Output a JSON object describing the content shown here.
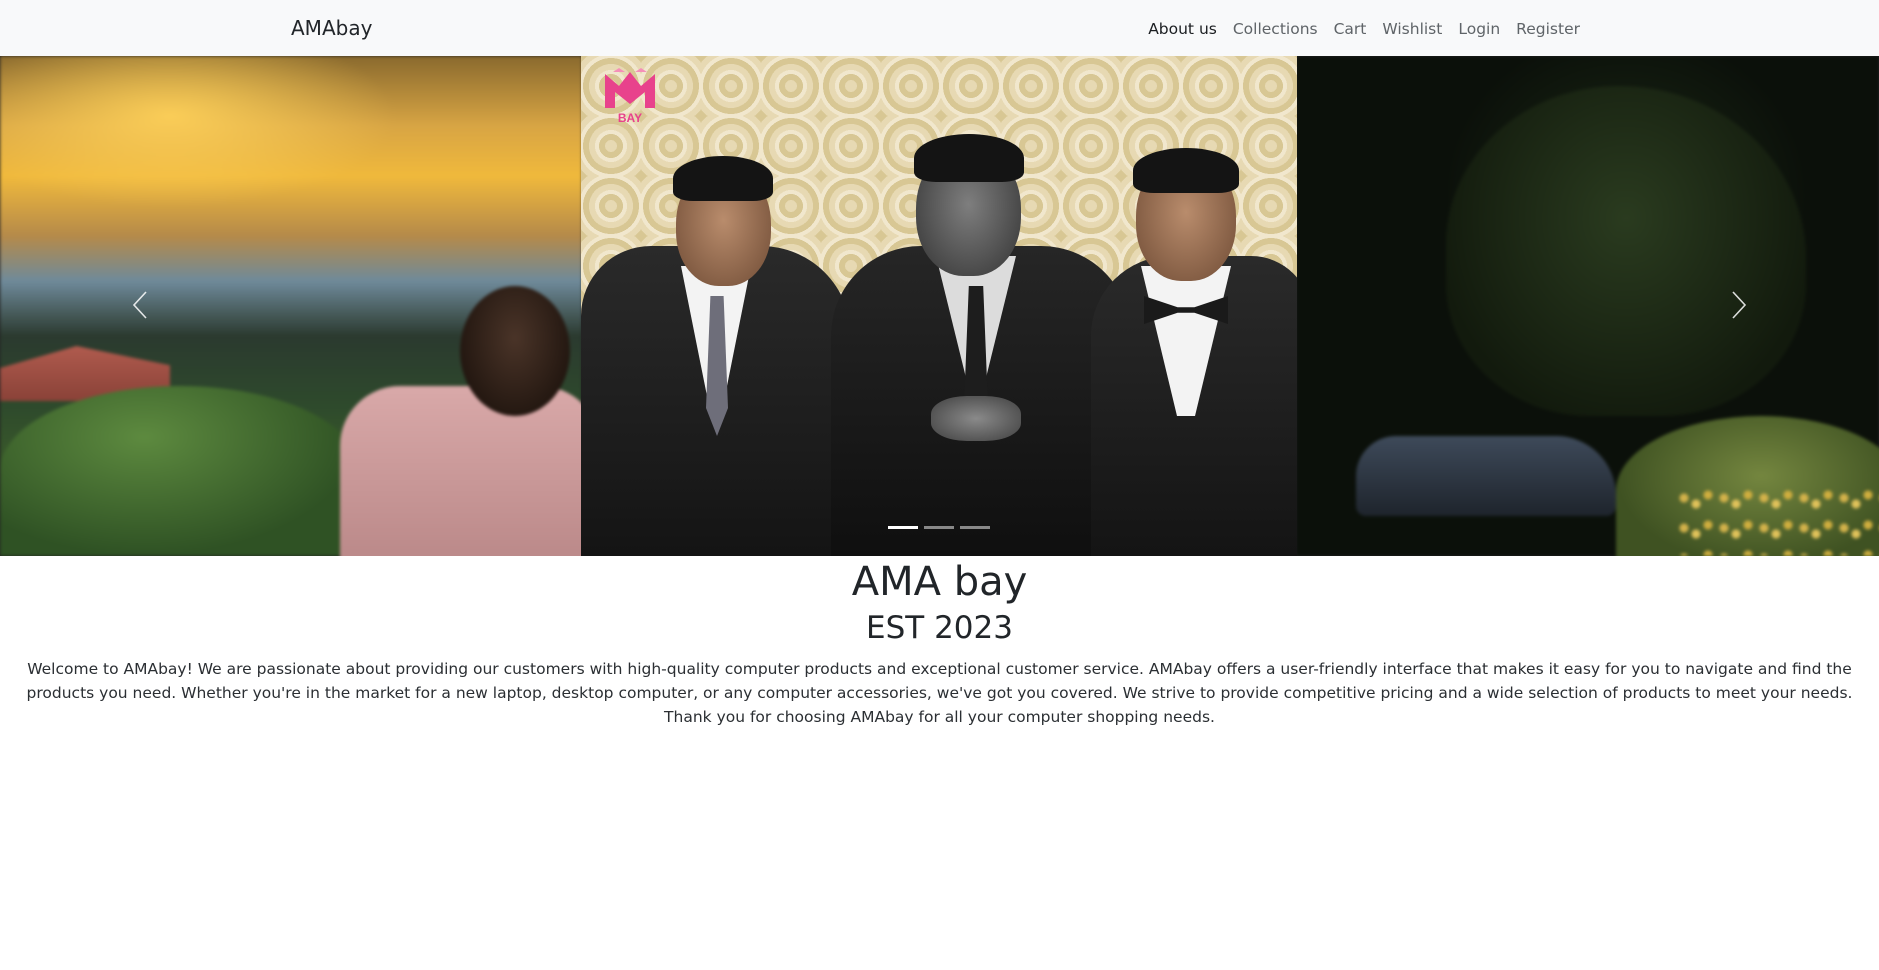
{
  "navbar": {
    "brand": "AMAbay",
    "links": [
      {
        "label": "About us",
        "active": true
      },
      {
        "label": "Collections",
        "active": false
      },
      {
        "label": "Cart",
        "active": false
      },
      {
        "label": "Wishlist",
        "active": false
      },
      {
        "label": "Login",
        "active": false
      },
      {
        "label": "Register",
        "active": false
      }
    ]
  },
  "carousel": {
    "logo_text": "BAY",
    "prev_icon": "chevron-left-icon",
    "next_icon": "chevron-right-icon",
    "slide_count": 3,
    "active_slide": 1
  },
  "about": {
    "title": "AMA bay",
    "subtitle": "EST 2023",
    "description": "Welcome to AMAbay! We are passionate about providing our customers with high-quality computer products and exceptional customer service. AMAbay offers a user-friendly interface that makes it easy for you to navigate and find the products you need. Whether you're in the market for a new laptop, desktop computer, or any computer accessories, we've got you covered. We strive to provide competitive pricing and a wide selection of products to meet your needs. Thank you for choosing AMAbay for all your computer shopping needs."
  },
  "colors": {
    "navbar_bg": "#f8f9fa",
    "text": "#212529",
    "nav_link": "#5f6468",
    "logo_pink": "#e8428c"
  }
}
